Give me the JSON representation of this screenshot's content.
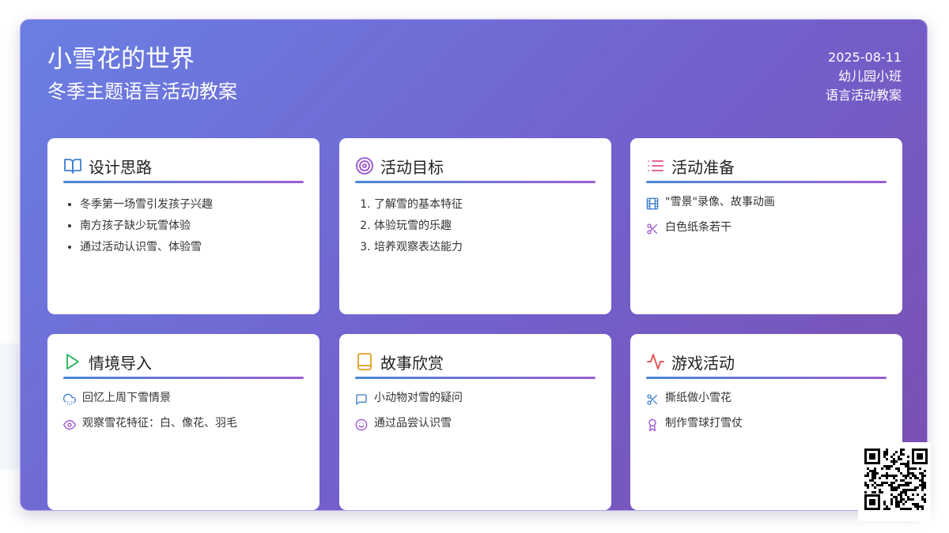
{
  "header": {
    "title": "小雪花的世界",
    "subtitle": "冬季主题语言活动教案",
    "date": "2025-08-11",
    "grade": "幼儿园小班",
    "category": "语言活动教案"
  },
  "cards": [
    {
      "title": "设计思路",
      "icon": "open-book-icon",
      "icon_color": "#3f7fd0",
      "items": [
        "冬季第一场雪引发孩子兴趣",
        "南方孩子缺少玩雪体验",
        "通过活动认识雪、体验雪"
      ]
    },
    {
      "title": "活动目标",
      "icon": "target-icon",
      "icon_color": "#9b4fd0",
      "items": [
        "了解雪的基本特征",
        "体验玩雪的乐趣",
        "培养观察表达能力"
      ]
    },
    {
      "title": "活动准备",
      "icon": "list-icon",
      "icon_color": "#e04f8c",
      "items": [
        {
          "icon": "film-icon",
          "text": "\"雪景\"录像、故事动画"
        },
        {
          "icon": "scissors-icon",
          "text": "白色纸条若干"
        }
      ]
    },
    {
      "title": "情境导入",
      "icon": "play-icon",
      "icon_color": "#22b35a",
      "items": [
        {
          "icon": "snow-cloud-icon",
          "text": "回忆上周下雪情景"
        },
        {
          "icon": "eye-icon",
          "text": "观察雪花特征：白、像花、羽毛"
        }
      ]
    },
    {
      "title": "故事欣赏",
      "icon": "book-icon",
      "icon_color": "#e0a020",
      "items": [
        {
          "icon": "chat-icon",
          "text": "小动物对雪的疑问"
        },
        {
          "icon": "smile-icon",
          "text": "通过品尝认识雪"
        }
      ]
    },
    {
      "title": "游戏活动",
      "icon": "activity-icon",
      "icon_color": "#e04a4a",
      "items": [
        {
          "icon": "scissors-icon",
          "text": "撕纸做小雪花"
        },
        {
          "icon": "award-icon",
          "text": "制作雪球打雪仗"
        }
      ]
    }
  ],
  "colors": {
    "accent_blue": "#4a89d4",
    "accent_purple": "#9b5fd0"
  }
}
